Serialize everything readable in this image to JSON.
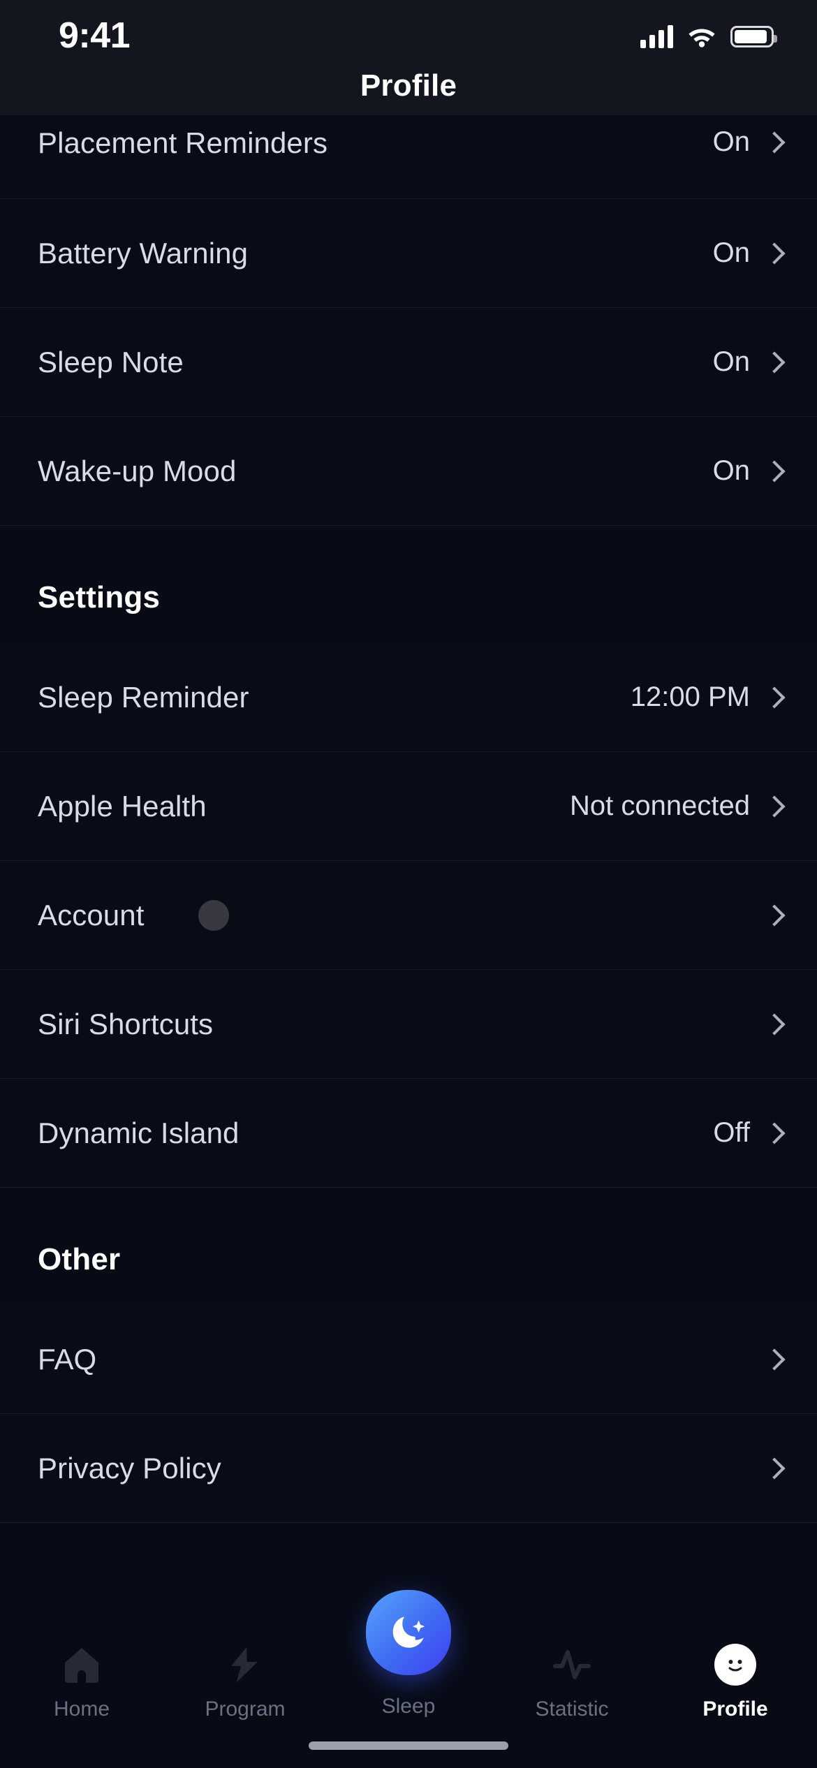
{
  "status_bar": {
    "time": "9:41",
    "signal_icon": "cellular-signal-icon",
    "wifi_icon": "wifi-icon",
    "battery_icon": "battery-icon"
  },
  "header": {
    "title": "Profile"
  },
  "notifications_section": {
    "rows": [
      {
        "label": "Placement Reminders",
        "value": "On"
      },
      {
        "label": "Battery Warning",
        "value": "On"
      },
      {
        "label": "Sleep Note",
        "value": "On"
      },
      {
        "label": "Wake-up Mood",
        "value": "On"
      }
    ]
  },
  "settings_section": {
    "title": "Settings",
    "rows": [
      {
        "label": "Sleep Reminder",
        "value": "12:00 PM"
      },
      {
        "label": "Apple Health",
        "value": "Not connected"
      },
      {
        "label": "Account",
        "value": ""
      },
      {
        "label": "Siri Shortcuts",
        "value": ""
      },
      {
        "label": "Dynamic Island",
        "value": "Off"
      }
    ]
  },
  "other_section": {
    "title": "Other",
    "rows": [
      {
        "label": "FAQ",
        "value": ""
      },
      {
        "label": "Privacy Policy",
        "value": ""
      }
    ]
  },
  "tab_bar": {
    "items": [
      {
        "label": "Home",
        "icon": "home-icon",
        "active": false
      },
      {
        "label": "Program",
        "icon": "lightning-bolt-icon",
        "active": false
      },
      {
        "label": "Sleep",
        "icon": "moon-star-icon",
        "active": false
      },
      {
        "label": "Statistic",
        "icon": "pulse-wave-icon",
        "active": false
      },
      {
        "label": "Profile",
        "icon": "avatar-face-icon",
        "active": true
      }
    ]
  },
  "colors": {
    "background": "#080b16",
    "header_background": "#13161f",
    "row_background": "#090c17",
    "divider": "#171b2b",
    "primary_text": "#ffffff",
    "secondary_text": "#d7dce8",
    "muted_text": "#6a7183",
    "accent_gradient_start": "#57a4fb",
    "accent_gradient_end": "#3f3ff0",
    "avatar_placeholder": "#383840"
  }
}
